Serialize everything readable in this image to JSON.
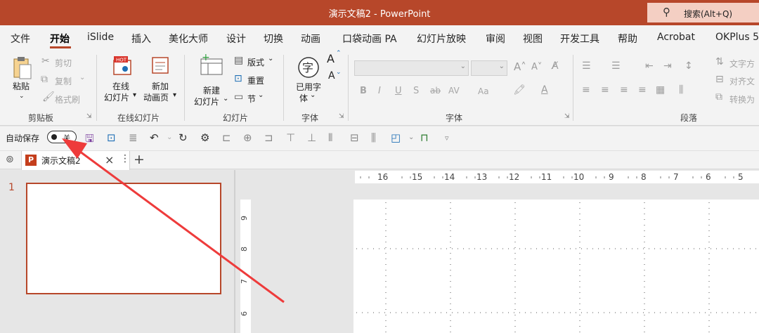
{
  "window": {
    "title": "演示文稿2 - PowerPoint",
    "search_label": "搜索(Alt+Q)"
  },
  "menu": [
    "文件",
    "开始",
    "iSlide",
    "插入",
    "美化大师",
    "设计",
    "切换",
    "动画",
    "口袋动画 PA",
    "幻灯片放映",
    "审阅",
    "视图",
    "开发工具",
    "帮助",
    "Acrobat",
    "OKPlus 5"
  ],
  "ribbon": {
    "clipboard": {
      "paste": "粘贴",
      "cut": "剪切",
      "copy": "复制",
      "format_painter": "格式刷",
      "group": "剪贴板"
    },
    "online": {
      "online_slide_l1": "在线",
      "online_slide_l2": "幻灯片",
      "new_anim_l1": "新加",
      "new_anim_l2": "动画页",
      "group": "在线幻灯片",
      "hot": "HOT"
    },
    "slides": {
      "new_slide_l1": "新建",
      "new_slide_l2": "幻灯片",
      "layout": "版式",
      "reset": "重置",
      "section": "节",
      "group": "幻灯片"
    },
    "font_tool": {
      "used_font_l1": "已用字",
      "used_font_l2": "体",
      "group": "字体",
      "glyph": "字"
    },
    "font": {
      "group": "字体",
      "buttons": [
        "B",
        "I",
        "U",
        "S",
        "ab",
        "AV",
        "Aa"
      ],
      "grow": "A",
      "shrink": "A"
    },
    "paragraph": {
      "group": "段落",
      "text_dir": "文字方",
      "align_text": "对齐文",
      "convert": "转换为"
    }
  },
  "qat": {
    "autosave": "自动保存",
    "toggle_state": "关"
  },
  "tabs": {
    "doc_title": "演示文稿2",
    "app_icon": "P"
  },
  "workspace": {
    "slide_number": "1",
    "hruler_ticks": [
      "16",
      "15",
      "14",
      "13",
      "12",
      "11",
      "10",
      "9",
      "8",
      "7",
      "6",
      "5"
    ],
    "vruler_ticks": [
      "9",
      "8",
      "7",
      "6"
    ]
  },
  "colors": {
    "accent": "#b7472a",
    "arrow": "#ee3b3b"
  }
}
